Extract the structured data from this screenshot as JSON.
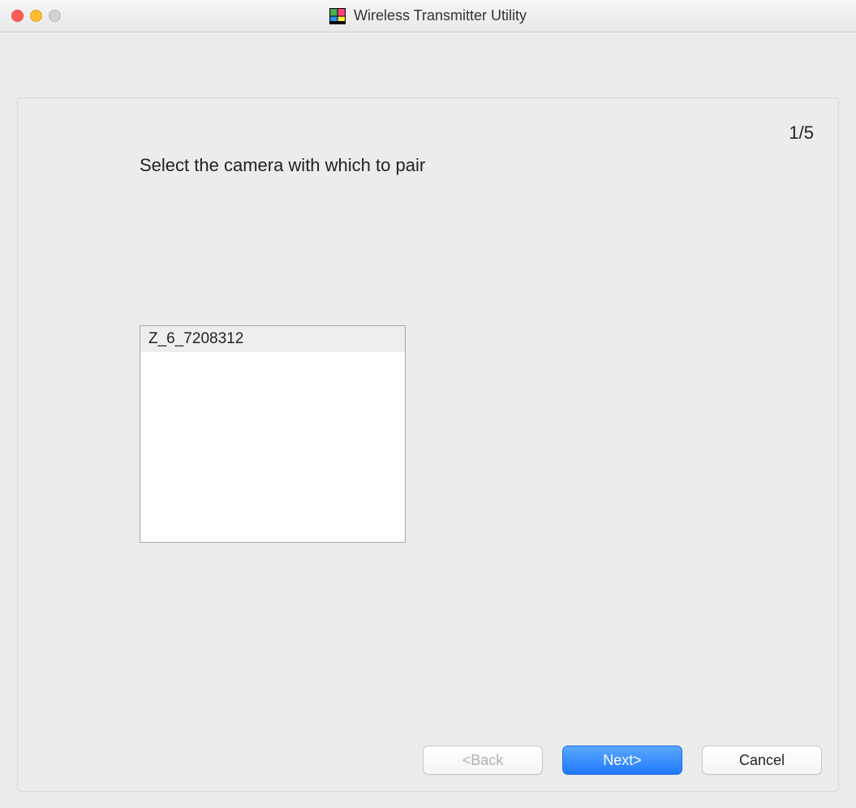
{
  "titlebar": {
    "title": "Wireless Transmitter Utility"
  },
  "panel": {
    "step_indicator": "1/5",
    "instruction": "Select the camera with which to pair",
    "cameras": [
      {
        "label": "Z_6_7208312",
        "selected": true
      }
    ]
  },
  "buttons": {
    "back": "<Back",
    "next": "Next>",
    "cancel": "Cancel"
  }
}
